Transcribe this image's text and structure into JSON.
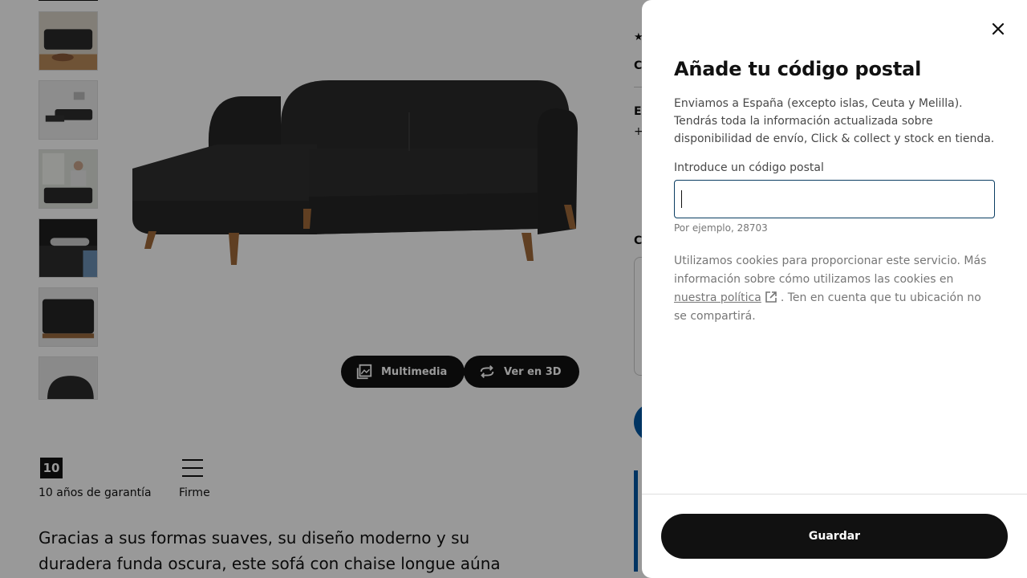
{
  "background_page": {
    "media_buttons": {
      "multimedia_label": "Multimedia",
      "view3d_label": "Ver en 3D"
    },
    "features": [
      {
        "badge": "10",
        "label": "10 años de garantía"
      },
      {
        "label": "Firme"
      }
    ],
    "description": "Gracias a sus formas suaves, su diseño moderno y su duradera funda oscura, este sofá con chaise longue aúna",
    "right_column_fragments": {
      "rating_star": "★",
      "heading_c": "C",
      "heading_el": "El",
      "plus": "+",
      "heading_c2": "C"
    }
  },
  "modal": {
    "title": "Añade tu código postal",
    "intro": "Enviamos a España (excepto islas, Ceuta y Melilla). Tendrás toda la información actualizada sobre disponibilidad de envío, Click & collect y stock en tienda.",
    "input_label": "Introduce un código postal",
    "input_value": "",
    "helper_text": "Por ejemplo, 28703",
    "cookie_text_before": "Utilizamos cookies para proporcionar este servicio. Más información sobre cómo utilizamos las cookies en ",
    "cookie_link": "nuestra política",
    "cookie_text_after": ". Ten en cuenta que tu ubicación no se compartirá.",
    "save_label": "Guardar"
  },
  "colors": {
    "accent_blue": "#0058a3",
    "button_dark": "#111111",
    "overlay": "rgba(0,0,0,0.4)"
  }
}
